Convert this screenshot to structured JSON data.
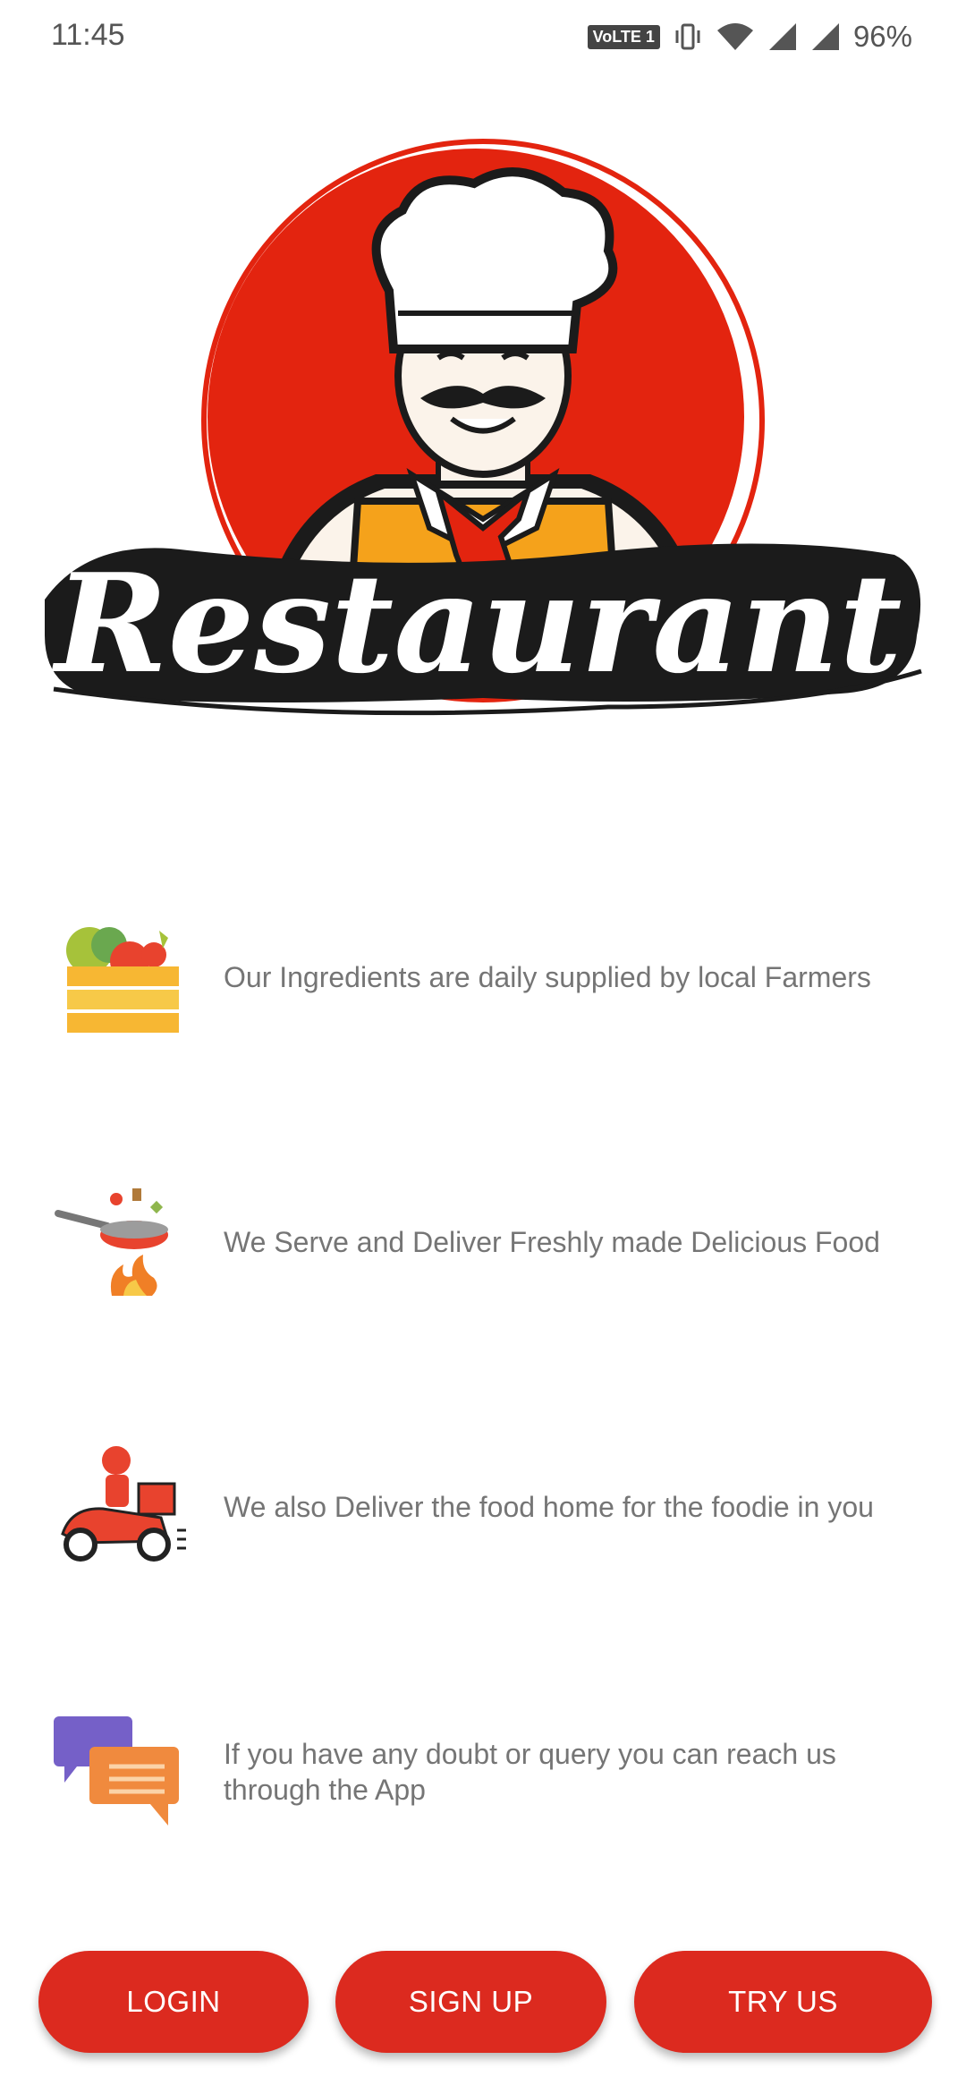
{
  "status_bar": {
    "time": "11:45",
    "volte": "VoLTE 1",
    "battery": "96%"
  },
  "logo": {
    "text": "Restaurant",
    "colors": {
      "circle": "#e3240f",
      "apron": "#f5a21b",
      "scarf": "#e3240f",
      "banner": "#1a1a1a"
    }
  },
  "features": [
    {
      "icon": "vegetable-crate-icon",
      "text": "Our Ingredients are daily supplied by local Farmers"
    },
    {
      "icon": "frying-pan-fire-icon",
      "text": "We Serve and Deliver Freshly made Delicious Food"
    },
    {
      "icon": "delivery-scooter-icon",
      "text": "We also Deliver the food home for the foodie in you"
    },
    {
      "icon": "chat-bubbles-icon",
      "text": "If you have any doubt or query you can reach us through the App"
    }
  ],
  "buttons": {
    "login": "LOGIN",
    "signup": "SIGN UP",
    "try": "TRY US"
  },
  "colors": {
    "accent": "#dc2a1f",
    "text_muted": "#757575"
  }
}
